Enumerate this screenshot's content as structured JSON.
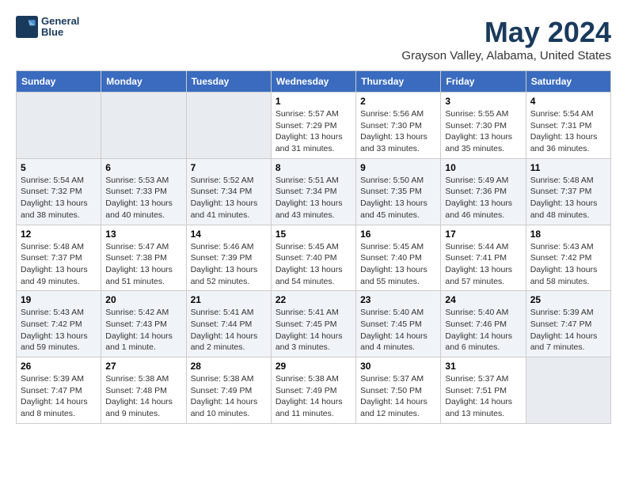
{
  "logo": {
    "line1": "General",
    "line2": "Blue"
  },
  "title": "May 2024",
  "subtitle": "Grayson Valley, Alabama, United States",
  "days_of_week": [
    "Sunday",
    "Monday",
    "Tuesday",
    "Wednesday",
    "Thursday",
    "Friday",
    "Saturday"
  ],
  "weeks": [
    [
      {
        "day": "",
        "info": ""
      },
      {
        "day": "",
        "info": ""
      },
      {
        "day": "",
        "info": ""
      },
      {
        "day": "1",
        "info": "Sunrise: 5:57 AM\nSunset: 7:29 PM\nDaylight: 13 hours\nand 31 minutes."
      },
      {
        "day": "2",
        "info": "Sunrise: 5:56 AM\nSunset: 7:30 PM\nDaylight: 13 hours\nand 33 minutes."
      },
      {
        "day": "3",
        "info": "Sunrise: 5:55 AM\nSunset: 7:30 PM\nDaylight: 13 hours\nand 35 minutes."
      },
      {
        "day": "4",
        "info": "Sunrise: 5:54 AM\nSunset: 7:31 PM\nDaylight: 13 hours\nand 36 minutes."
      }
    ],
    [
      {
        "day": "5",
        "info": "Sunrise: 5:54 AM\nSunset: 7:32 PM\nDaylight: 13 hours\nand 38 minutes."
      },
      {
        "day": "6",
        "info": "Sunrise: 5:53 AM\nSunset: 7:33 PM\nDaylight: 13 hours\nand 40 minutes."
      },
      {
        "day": "7",
        "info": "Sunrise: 5:52 AM\nSunset: 7:34 PM\nDaylight: 13 hours\nand 41 minutes."
      },
      {
        "day": "8",
        "info": "Sunrise: 5:51 AM\nSunset: 7:34 PM\nDaylight: 13 hours\nand 43 minutes."
      },
      {
        "day": "9",
        "info": "Sunrise: 5:50 AM\nSunset: 7:35 PM\nDaylight: 13 hours\nand 45 minutes."
      },
      {
        "day": "10",
        "info": "Sunrise: 5:49 AM\nSunset: 7:36 PM\nDaylight: 13 hours\nand 46 minutes."
      },
      {
        "day": "11",
        "info": "Sunrise: 5:48 AM\nSunset: 7:37 PM\nDaylight: 13 hours\nand 48 minutes."
      }
    ],
    [
      {
        "day": "12",
        "info": "Sunrise: 5:48 AM\nSunset: 7:37 PM\nDaylight: 13 hours\nand 49 minutes."
      },
      {
        "day": "13",
        "info": "Sunrise: 5:47 AM\nSunset: 7:38 PM\nDaylight: 13 hours\nand 51 minutes."
      },
      {
        "day": "14",
        "info": "Sunrise: 5:46 AM\nSunset: 7:39 PM\nDaylight: 13 hours\nand 52 minutes."
      },
      {
        "day": "15",
        "info": "Sunrise: 5:45 AM\nSunset: 7:40 PM\nDaylight: 13 hours\nand 54 minutes."
      },
      {
        "day": "16",
        "info": "Sunrise: 5:45 AM\nSunset: 7:40 PM\nDaylight: 13 hours\nand 55 minutes."
      },
      {
        "day": "17",
        "info": "Sunrise: 5:44 AM\nSunset: 7:41 PM\nDaylight: 13 hours\nand 57 minutes."
      },
      {
        "day": "18",
        "info": "Sunrise: 5:43 AM\nSunset: 7:42 PM\nDaylight: 13 hours\nand 58 minutes."
      }
    ],
    [
      {
        "day": "19",
        "info": "Sunrise: 5:43 AM\nSunset: 7:42 PM\nDaylight: 13 hours\nand 59 minutes."
      },
      {
        "day": "20",
        "info": "Sunrise: 5:42 AM\nSunset: 7:43 PM\nDaylight: 14 hours\nand 1 minute."
      },
      {
        "day": "21",
        "info": "Sunrise: 5:41 AM\nSunset: 7:44 PM\nDaylight: 14 hours\nand 2 minutes."
      },
      {
        "day": "22",
        "info": "Sunrise: 5:41 AM\nSunset: 7:45 PM\nDaylight: 14 hours\nand 3 minutes."
      },
      {
        "day": "23",
        "info": "Sunrise: 5:40 AM\nSunset: 7:45 PM\nDaylight: 14 hours\nand 4 minutes."
      },
      {
        "day": "24",
        "info": "Sunrise: 5:40 AM\nSunset: 7:46 PM\nDaylight: 14 hours\nand 6 minutes."
      },
      {
        "day": "25",
        "info": "Sunrise: 5:39 AM\nSunset: 7:47 PM\nDaylight: 14 hours\nand 7 minutes."
      }
    ],
    [
      {
        "day": "26",
        "info": "Sunrise: 5:39 AM\nSunset: 7:47 PM\nDaylight: 14 hours\nand 8 minutes."
      },
      {
        "day": "27",
        "info": "Sunrise: 5:38 AM\nSunset: 7:48 PM\nDaylight: 14 hours\nand 9 minutes."
      },
      {
        "day": "28",
        "info": "Sunrise: 5:38 AM\nSunset: 7:49 PM\nDaylight: 14 hours\nand 10 minutes."
      },
      {
        "day": "29",
        "info": "Sunrise: 5:38 AM\nSunset: 7:49 PM\nDaylight: 14 hours\nand 11 minutes."
      },
      {
        "day": "30",
        "info": "Sunrise: 5:37 AM\nSunset: 7:50 PM\nDaylight: 14 hours\nand 12 minutes."
      },
      {
        "day": "31",
        "info": "Sunrise: 5:37 AM\nSunset: 7:51 PM\nDaylight: 14 hours\nand 13 minutes."
      },
      {
        "day": "",
        "info": ""
      }
    ]
  ]
}
